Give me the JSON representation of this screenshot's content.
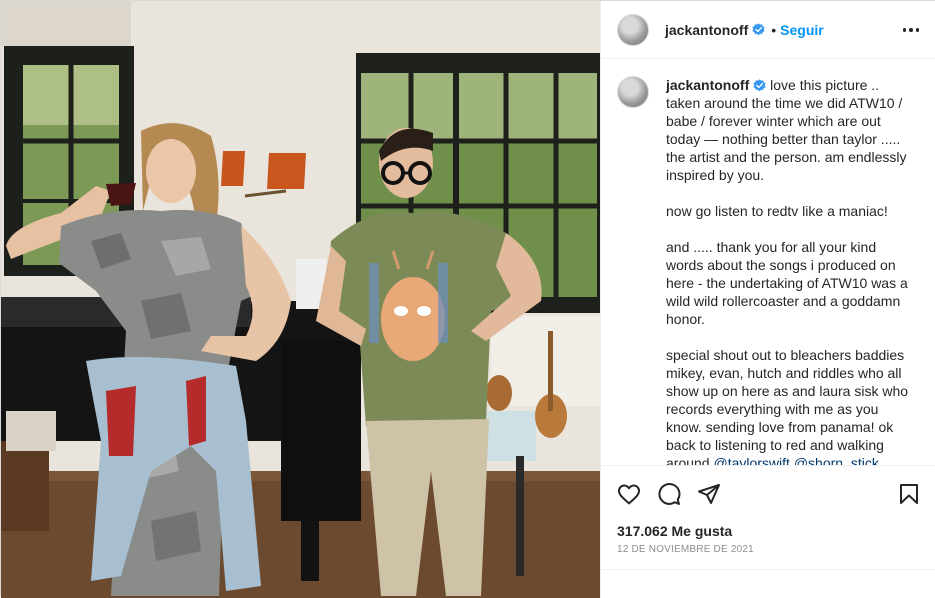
{
  "post": {
    "username": "jackantonoff",
    "follow_label": "Seguir",
    "separator": "•"
  },
  "caption": {
    "username": "jackantonoff",
    "paragraphs": [
      "love this picture .. taken around the time we did ATW10 / babe / forever winter which are out today — nothing better than taylor ..... the artist and the person. am endlessly inspired by you.",
      "now go listen to redtv like a maniac!",
      "and ..... thank you for all your kind words about the songs i produced on here - the undertaking of ATW10 was a wild wild rollercoaster and a goddamn honor.",
      "special shout out to bleachers baddies mikey, evan, hutch and riddles who all show up on here as and laura sisk who records everything with me as you know. sending love from panama! ok back to listening to red and walking"
    ],
    "last_line_prefix": "around",
    "mentions": [
      "@taylorswift",
      "@shorn_stick"
    ]
  },
  "stats": {
    "likes": "317.062 Me gusta",
    "date": "12 de noviembre de 2021"
  },
  "icons": {
    "verified": "verified-badge-icon",
    "more": "more-options-icon",
    "like": "heart-icon",
    "comment": "comment-icon",
    "share": "share-icon",
    "save": "bookmark-icon"
  },
  "colors": {
    "accent": "#0095f6",
    "text": "#262626",
    "muted": "#8e8e8e",
    "verified": "#3897f0"
  }
}
